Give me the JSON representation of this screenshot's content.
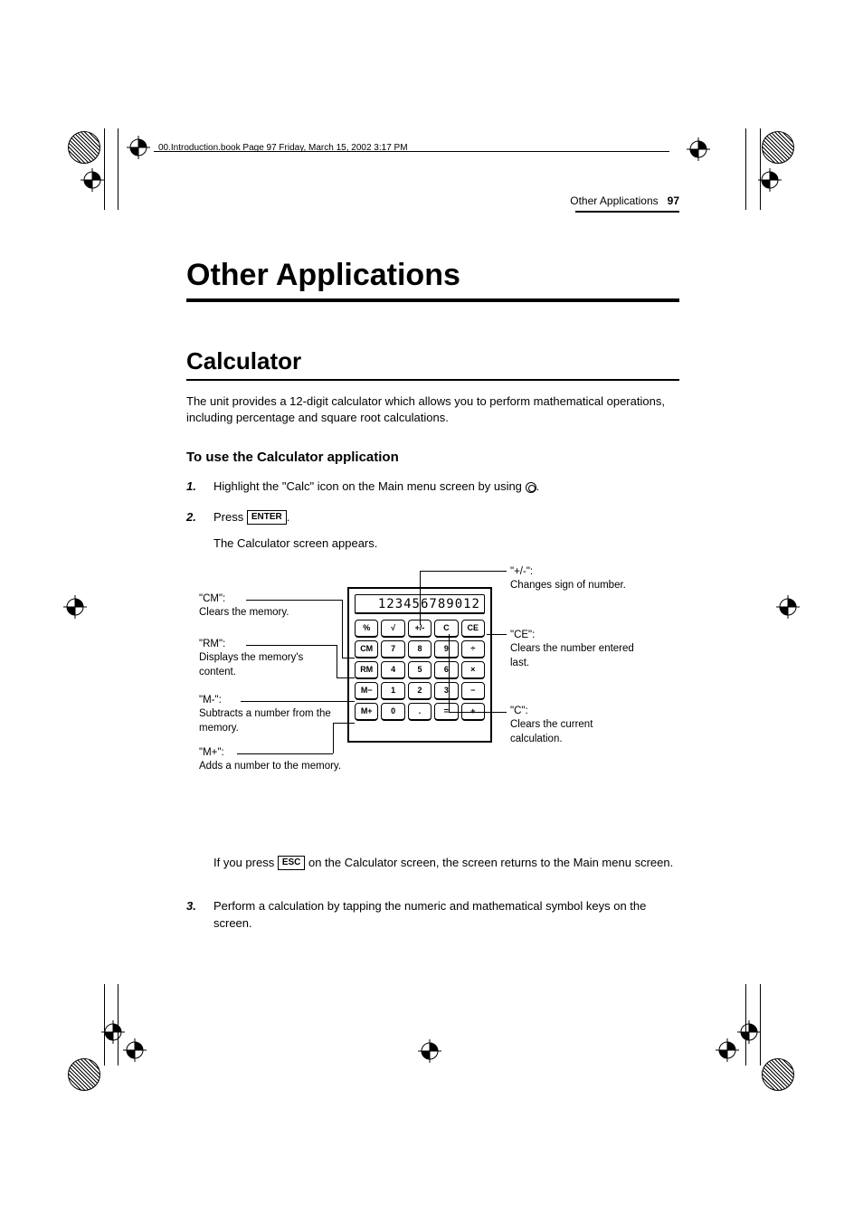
{
  "crop_header": "00.Introduction.book  Page 97  Friday, March 15, 2002  3:17 PM",
  "running_head": {
    "section": "Other Applications",
    "page": "97"
  },
  "chapter_title": "Other Applications",
  "section_title": "Calculator",
  "intro": "The unit provides a 12-digit calculator which allows you to perform mathematical operations, including percentage and square root calculations.",
  "subhead": "To use the Calculator application",
  "steps": {
    "s1_pre": "Highlight the \"Calc\" icon on the Main menu screen by using ",
    "s1_post": ".",
    "s2_pre": "Press ",
    "s2_key": "ENTER",
    "s2_post": ".",
    "s2_sub": "The Calculator screen appears.",
    "s3": "Perform a calculation by tapping the numeric and mathematical symbol keys on the screen."
  },
  "esc_note_pre": "If you press ",
  "esc_key": "ESC",
  "esc_note_post": " on the Calculator screen, the screen returns to the Main menu screen.",
  "calc": {
    "display": "123456789012",
    "keys": [
      "%",
      "√",
      "+/-",
      "C",
      "CE",
      "CM",
      "7",
      "8",
      "9",
      "÷",
      "RM",
      "4",
      "5",
      "6",
      "×",
      "M−",
      "1",
      "2",
      "3",
      "−",
      "M+",
      "0",
      ".",
      "=",
      "+"
    ]
  },
  "callouts": {
    "cm": {
      "title": "\"CM\":",
      "desc": "Clears the memory."
    },
    "rm": {
      "title": "\"RM\":",
      "desc": "Displays the memory's content."
    },
    "mm": {
      "title": "\"M-\":",
      "desc": "Subtracts a number from the memory."
    },
    "mp": {
      "title": "\"M+\":",
      "desc": "Adds a number to the memory."
    },
    "pm": {
      "title": "\"+/-\":",
      "desc": "Changes sign of number."
    },
    "ce": {
      "title": "\"CE\":",
      "desc": "Clears the number entered last."
    },
    "c": {
      "title": "\"C\":",
      "desc": "Clears the current calculation."
    }
  }
}
